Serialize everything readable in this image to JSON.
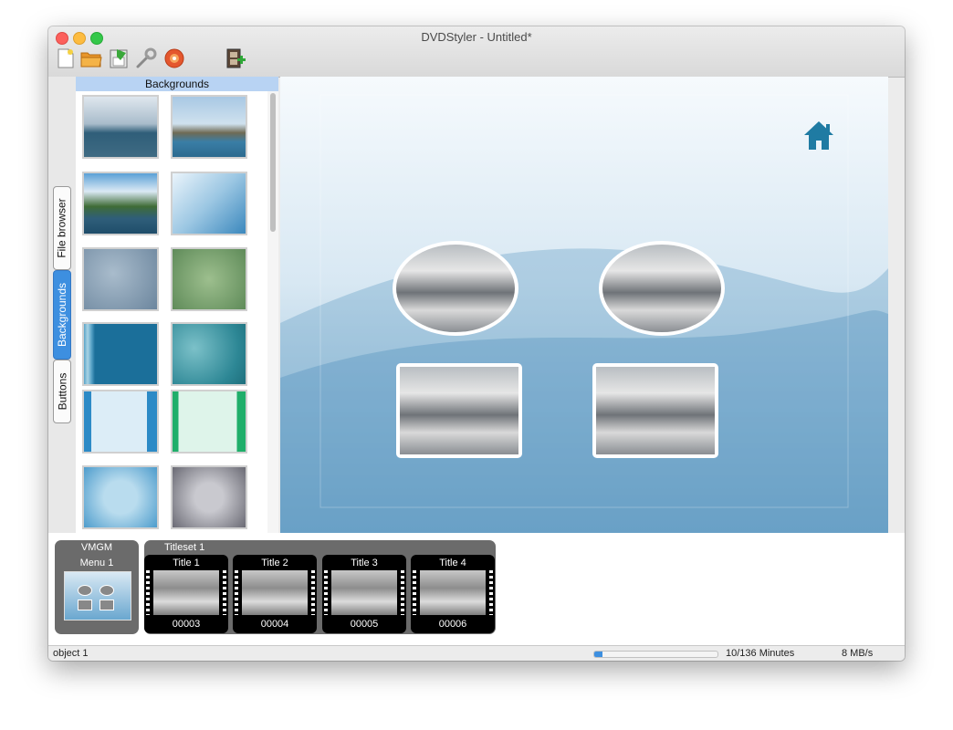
{
  "window": {
    "title": "DVDStyler - Untitled*"
  },
  "toolbar": {
    "icons": [
      "new-file-icon",
      "open-folder-icon",
      "save-icon",
      "settings-wrench-icon",
      "burn-disc-icon",
      "add-video-icon"
    ]
  },
  "side_tabs": [
    "File browser",
    "Backgrounds",
    "Buttons"
  ],
  "active_tab": "Backgrounds",
  "panel": {
    "header": "Backgrounds"
  },
  "backgrounds": [
    {
      "name": "sky-sea"
    },
    {
      "name": "coast-boats"
    },
    {
      "name": "lake-hills"
    },
    {
      "name": "blue-light"
    },
    {
      "name": "gray-cloud"
    },
    {
      "name": "green-cloud"
    },
    {
      "name": "blue-stripes"
    },
    {
      "name": "teal-texture"
    },
    {
      "name": "blue-frame"
    },
    {
      "name": "green-frame"
    },
    {
      "name": "blue-gradient"
    },
    {
      "name": "gray-gradient"
    }
  ],
  "canvas": {
    "home_icon": "home-icon"
  },
  "vmgm": {
    "label": "VMGM",
    "menu_label": "Menu 1"
  },
  "titleset": {
    "label": "Titleset 1",
    "titles": [
      {
        "label": "Title 1",
        "number": "00003"
      },
      {
        "label": "Title 2",
        "number": "00004"
      },
      {
        "label": "Title 3",
        "number": "00005"
      },
      {
        "label": "Title 4",
        "number": "00006"
      }
    ]
  },
  "status": {
    "left": "object 1",
    "minutes": "10/136 Minutes",
    "rate": "8 MB/s",
    "progress": 0.07
  },
  "colors": {
    "accent": "#3d8fe0",
    "panel_header": "#b8d3f3",
    "home_icon": "#1f7ba3"
  }
}
